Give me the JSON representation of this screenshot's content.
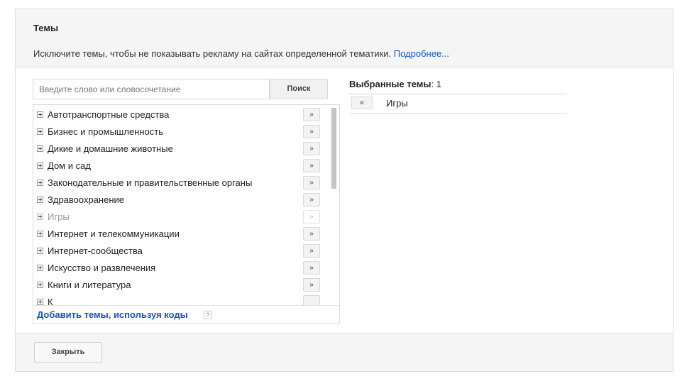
{
  "header": {
    "title": "Темы",
    "description": "Исключите темы, чтобы не показывать рекламу на сайтах определенной тематики.",
    "more_link": "Подробнее..."
  },
  "search": {
    "placeholder": "Введите слово или словосочетание",
    "button_label": "Поиск"
  },
  "topics": [
    {
      "label": "Автотранспортные средства",
      "add": "»"
    },
    {
      "label": "Бизнес и промышленность",
      "add": "»"
    },
    {
      "label": "Дикие и домашние животные",
      "add": "»"
    },
    {
      "label": "Дом и сад",
      "add": "»"
    },
    {
      "label": "Законодательные и правительственные органы",
      "add": "»"
    },
    {
      "label": "Здравоохранение",
      "add": "»"
    },
    {
      "label": "Игры",
      "add": "»"
    },
    {
      "label": "Интернет и телекоммуникации",
      "add": "»"
    },
    {
      "label": "Интернет-сообщества",
      "add": "»"
    },
    {
      "label": "Искусство и развлечения",
      "add": "»"
    },
    {
      "label": "Книги и литература",
      "add": "»"
    },
    {
      "label": "К",
      "add": ""
    }
  ],
  "codes_link": "Добавить темы, используя коды",
  "help_icon": "?",
  "selected": {
    "title": "Выбранные темы",
    "count": ": 1",
    "items": [
      {
        "label": "Игры",
        "remove": "«"
      }
    ]
  },
  "footer": {
    "close_label": "Закрыть"
  },
  "colors": {
    "link": "#1155cc",
    "header_bg": "#f5f5f5",
    "border": "#dcdcdc"
  }
}
